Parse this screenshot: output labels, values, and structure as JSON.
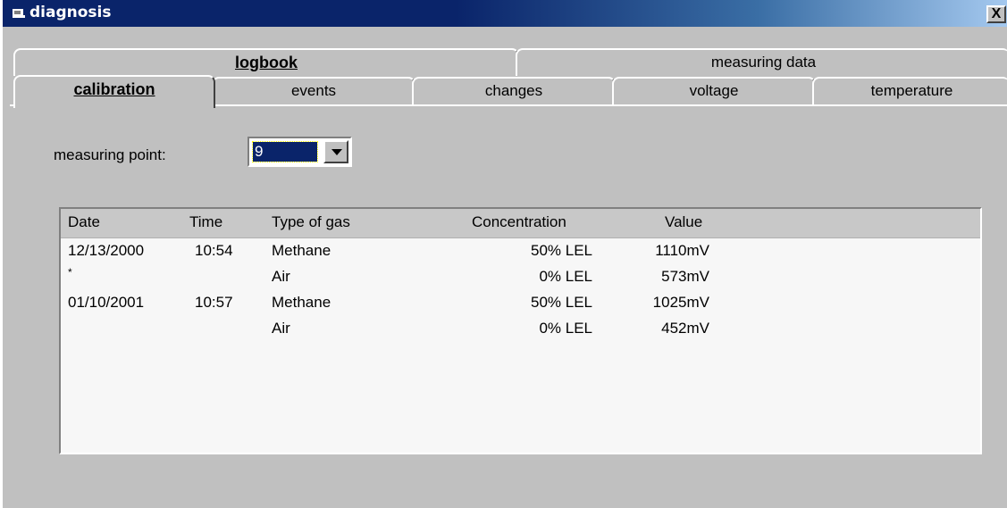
{
  "window": {
    "title": "diagnosis",
    "close_label": "X"
  },
  "tabs_upper": [
    "logbook",
    "measuring data"
  ],
  "tabs_lower": [
    "calibration",
    "events",
    "changes",
    "voltage",
    "temperature"
  ],
  "measuring_point": {
    "label": "measuring point:",
    "value": "9"
  },
  "table": {
    "columns": [
      "Date",
      "Time",
      "Type of gas",
      "Concentration",
      "Value"
    ],
    "rows": [
      [
        "12/13/2000",
        "10:54",
        "Methane",
        "50% LEL",
        "1110mV"
      ],
      [
        "*",
        "",
        "Air",
        "0% LEL",
        "573mV"
      ],
      [
        "01/10/2001",
        "10:57",
        "Methane",
        "50% LEL",
        "1025mV"
      ],
      [
        "",
        "",
        "Air",
        "0% LEL",
        "452mV"
      ]
    ]
  },
  "colors": {
    "titlebar": "#0a246a",
    "face": "#c0c0c0",
    "selection": "#0a246a"
  }
}
